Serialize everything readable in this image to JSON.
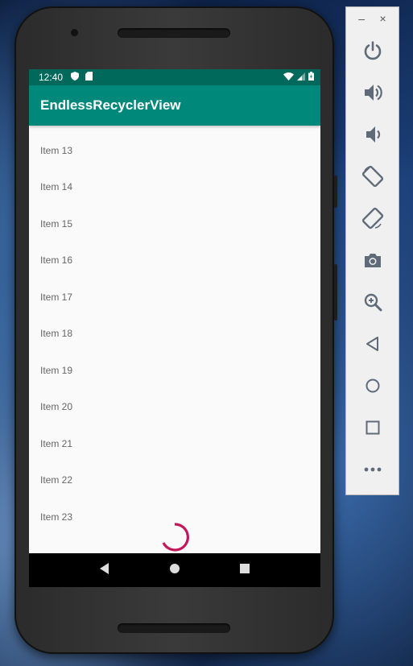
{
  "statusbar": {
    "time": "12:40"
  },
  "appbar": {
    "title": "EndlessRecyclerView"
  },
  "list": {
    "items": [
      "Item 13",
      "Item 14",
      "Item 15",
      "Item 16",
      "Item 17",
      "Item 18",
      "Item 19",
      "Item 20",
      "Item 21",
      "Item 22",
      "Item 23"
    ]
  },
  "colors": {
    "status_bar": "#00695c",
    "app_bar": "#00897b",
    "spinner": "#c2185b",
    "toolbar_icon": "#5f6b78"
  },
  "toolbar": {
    "window_controls": {
      "minimize": "–",
      "close": "×"
    },
    "buttons": [
      "power-icon",
      "volume-up-icon",
      "volume-down-icon",
      "rotate-left-icon",
      "rotate-right-icon",
      "camera-icon",
      "zoom-icon",
      "back-icon",
      "home-icon",
      "overview-icon",
      "more-icon"
    ]
  }
}
